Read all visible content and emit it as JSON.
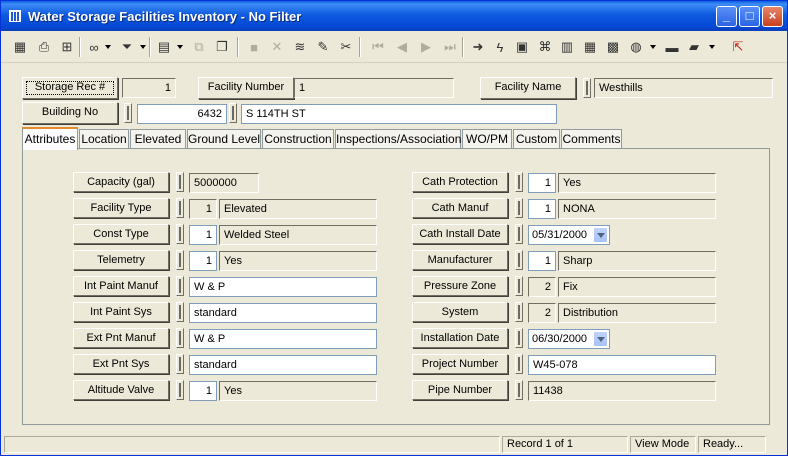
{
  "window": {
    "title": "Water Storage Facilities Inventory - No Filter",
    "controls": [
      "_",
      "□",
      "×"
    ]
  },
  "toolbar": {
    "icons": [
      "grid-icon",
      "print-icon",
      "print-preview-icon",
      "binoculars-icon",
      "filter-icon",
      "record-icon",
      "copy-icon",
      "paste-icon",
      "save-icon",
      "delete-icon",
      "stack-icon",
      "pencil-icon",
      "scissors-icon",
      "first-icon",
      "prev-icon",
      "next-icon",
      "last-icon",
      "goto-icon",
      "lightning-icon",
      "map-icon",
      "tree-icon",
      "chart-icon",
      "calculator-icon",
      "map-window-icon",
      "globe-icon",
      "keyboard-icon",
      "books-icon",
      "exit-icon"
    ]
  },
  "header": {
    "storage_rec_label": "Storage Rec #",
    "storage_rec_value": "1",
    "facility_number_label": "Facility Number",
    "facility_number_value": "1",
    "facility_name_label": "Facility Name",
    "facility_name_value": "Westhills",
    "building_no_label": "Building No",
    "building_no_value": "6432",
    "building_street": "S 114TH ST"
  },
  "tabs": [
    "Attributes",
    "Location",
    "Elevated",
    "Ground Level",
    "Construction",
    "Inspections/Associations",
    "WO/PM",
    "Custom",
    "Comments"
  ],
  "left_fields": [
    {
      "label": "Capacity (gal)",
      "code": "",
      "value": "5000000"
    },
    {
      "label": "Facility Type",
      "code": "1",
      "value": "Elevated"
    },
    {
      "label": "Const Type",
      "code": "1",
      "value": "Welded Steel"
    },
    {
      "label": "Telemetry",
      "code": "1",
      "value": "Yes"
    },
    {
      "label": "Int Paint Manuf",
      "code": "",
      "value": "W & P"
    },
    {
      "label": "Int Paint Sys",
      "code": "",
      "value": "standard"
    },
    {
      "label": "Ext Pnt Manuf",
      "code": "",
      "value": "W & P"
    },
    {
      "label": "Ext Pnt Sys",
      "code": "",
      "value": "standard"
    },
    {
      "label": "Altitude Valve",
      "code": "1",
      "value": "Yes"
    }
  ],
  "right_fields": [
    {
      "label": "Cath Protection",
      "code": "1",
      "value": "Yes"
    },
    {
      "label": "Cath Manuf",
      "code": "1",
      "value": "NONA"
    },
    {
      "label": "Cath Install Date",
      "code": "",
      "value": "05/31/2000"
    },
    {
      "label": "Manufacturer",
      "code": "1",
      "value": "Sharp"
    },
    {
      "label": "Pressure Zone",
      "code": "2",
      "value": "Fix"
    },
    {
      "label": "System",
      "code": "2",
      "value": "Distribution"
    },
    {
      "label": "Installation Date",
      "code": "",
      "value": "06/30/2000"
    },
    {
      "label": "Project Number",
      "code": "",
      "value": "W45-078"
    },
    {
      "label": "Pipe Number",
      "code": "",
      "value": "11438"
    }
  ],
  "status": {
    "record": "Record 1 of 1",
    "mode": "View Mode",
    "state": "Ready..."
  }
}
